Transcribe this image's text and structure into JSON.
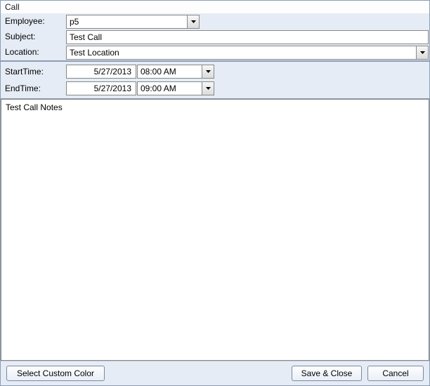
{
  "window": {
    "title": "Call"
  },
  "labels": {
    "employee": "Employee:",
    "subject": "Subject:",
    "location": "Location:",
    "startTime": "StartTime:",
    "endTime": "EndTime:"
  },
  "fields": {
    "employee": "p5",
    "subject": "Test Call",
    "location": "Test Location",
    "startDate": "5/27/2013",
    "startTime": "08:00 AM",
    "endDate": "5/27/2013",
    "endTime": "09:00 AM"
  },
  "notes": "Test Call Notes",
  "buttons": {
    "selectColor": "Select Custom Color",
    "saveClose": "Save & Close",
    "cancel": "Cancel"
  }
}
